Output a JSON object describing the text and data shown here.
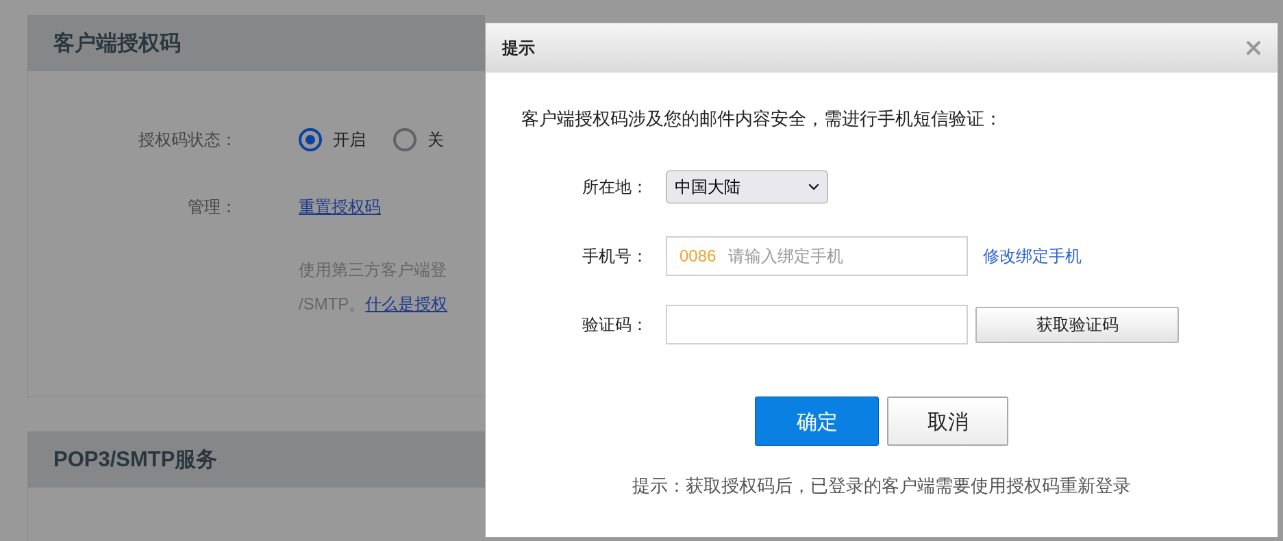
{
  "page": {
    "sections": [
      {
        "title": "客户端授权码",
        "status_label": "授权码状态：",
        "radios": [
          {
            "label": "开启",
            "selected": true
          },
          {
            "label": "关",
            "selected": false
          }
        ],
        "manage_label": "管理：",
        "manage_link": "重置授权码",
        "description": {
          "line_1": "使用第三方客户端登",
          "line_2": "/SMTP。",
          "link": "什么是授权"
        }
      },
      {
        "title": "POP3/SMTP服务"
      }
    ]
  },
  "dialog": {
    "title": "提示",
    "intro": "客户端授权码涉及您的邮件内容安全，需进行手机短信验证：",
    "fields": [
      {
        "kind": "select",
        "label": "所在地：",
        "value": "中国大陆"
      },
      {
        "kind": "phone",
        "label": "手机号：",
        "prefix": "0086",
        "placeholder": "请输入绑定手机",
        "link": "修改绑定手机"
      },
      {
        "kind": "code",
        "label": "验证码：",
        "button": "获取验证码"
      }
    ],
    "buttons": [
      {
        "label": "确定",
        "kind": "primary"
      },
      {
        "label": "取消",
        "kind": "secondary"
      }
    ],
    "note": "提示：获取授权码后，已登录的客户端需要使用授权码重新登录"
  }
}
